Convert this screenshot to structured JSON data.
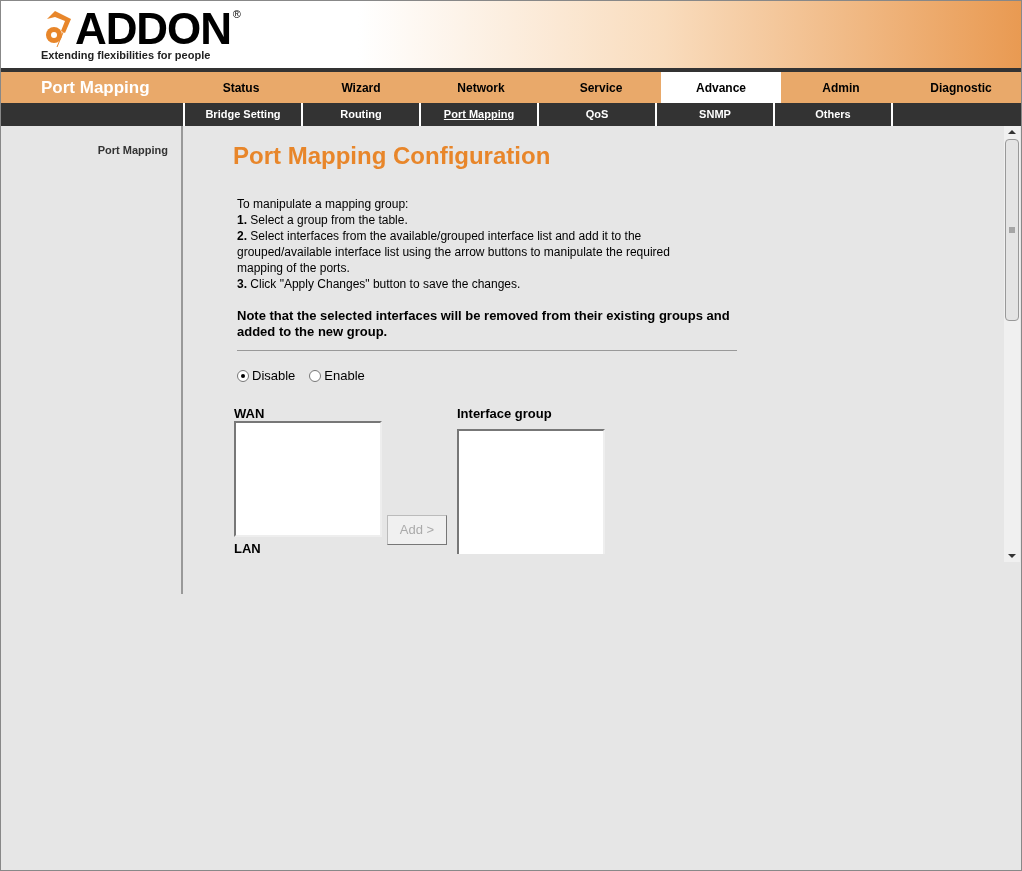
{
  "brand": {
    "name": "ADDON",
    "registered": "®",
    "tagline": "Extending flexibilities for people"
  },
  "page_title": "Port Mapping",
  "main_tabs": [
    {
      "label": "Status",
      "selected": false
    },
    {
      "label": "Wizard",
      "selected": false
    },
    {
      "label": "Network",
      "selected": false
    },
    {
      "label": "Service",
      "selected": false
    },
    {
      "label": "Advance",
      "selected": true
    },
    {
      "label": "Admin",
      "selected": false
    },
    {
      "label": "Diagnostic",
      "selected": false
    }
  ],
  "sub_tabs": [
    {
      "label": "Bridge Setting",
      "selected": false
    },
    {
      "label": "Routing",
      "selected": false
    },
    {
      "label": "Port Mapping",
      "selected": true
    },
    {
      "label": "QoS",
      "selected": false
    },
    {
      "label": "SNMP",
      "selected": false
    },
    {
      "label": "Others",
      "selected": false
    }
  ],
  "sidebar": {
    "items": [
      {
        "label": "Port Mapping",
        "selected": true
      }
    ]
  },
  "content": {
    "heading": "Port Mapping Configuration",
    "instructions": [
      "To manipulate a mapping group:",
      "**1.** Select a group from the table.",
      "**2.** Select interfaces from the available/grouped interface list and add it to the grouped/available interface list using the arrow buttons to manipulate the required mapping of the ports.",
      "**3.** Click \"Apply Changes\" button to save the changes."
    ],
    "note": "Note that the selected interfaces will be removed from their existing groups and added to the new group.",
    "radios": [
      {
        "label": "Disable",
        "selected": true
      },
      {
        "label": "Enable",
        "selected": false
      }
    ],
    "wan_label": "WAN",
    "lan_label": "LAN",
    "group_label": "Interface group",
    "add_button": {
      "label": "Add >",
      "disabled": true
    }
  }
}
